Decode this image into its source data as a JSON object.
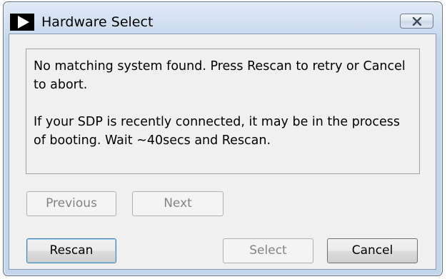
{
  "window": {
    "title": "Hardware Select",
    "icon": "play-arrow-icon",
    "close_icon": "close-icon"
  },
  "message": {
    "line1": "No matching system found. Press Rescan to retry or Cancel to abort.",
    "line2": "If your SDP is recently connected, it may be in the process of booting. Wait ~40secs and Rescan."
  },
  "buttons": {
    "previous": "Previous",
    "next": "Next",
    "rescan": "Rescan",
    "select": "Select",
    "cancel": "Cancel"
  },
  "colors": {
    "title_bar": "#c9daee",
    "disabled_text": "#838383"
  }
}
